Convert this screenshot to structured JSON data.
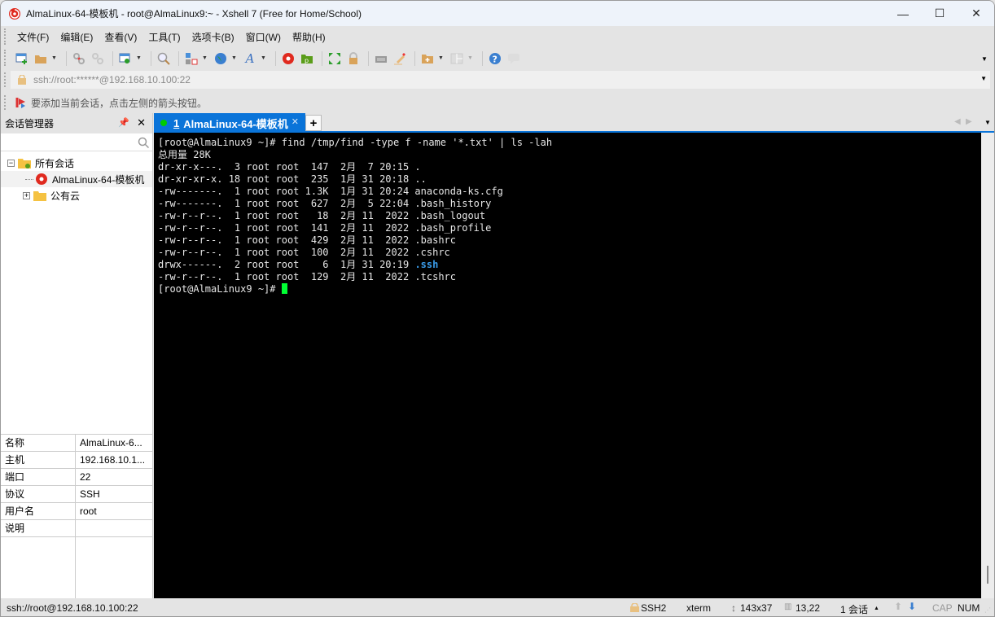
{
  "window": {
    "title": "AlmaLinux-64-模板机 - root@AlmaLinux9:~ - Xshell 7 (Free for Home/School)",
    "controls": {
      "minimize": "—",
      "maximize": "☐",
      "close": "✕"
    }
  },
  "menu": [
    "文件(F)",
    "编辑(E)",
    "查看(V)",
    "工具(T)",
    "选项卡(B)",
    "窗口(W)",
    "帮助(H)"
  ],
  "toolbar": {
    "icons": [
      "new-session-icon",
      "open-folder-icon",
      "disconnect-icon",
      "reconnect-icon",
      "session-properties-icon",
      "find-icon",
      "transfer-icon",
      "globe-icon",
      "font-icon",
      "xshell-icon",
      "xftp-icon",
      "fullscreen-icon",
      "lock-icon",
      "keyboard-icon",
      "highlight-icon",
      "new-tab-group-icon",
      "layout-icon",
      "help-icon",
      "chat-icon"
    ]
  },
  "address": {
    "value": "ssh://root:******@192.168.10.100:22"
  },
  "hint": "要添加当前会话，点击左侧的箭头按钮。",
  "session_manager": {
    "title": "会话管理器",
    "search_placeholder": "",
    "tree": {
      "root": "所有会话",
      "session": "AlmaLinux-64-模板机",
      "folder": "公有云"
    },
    "properties": [
      {
        "key": "名称",
        "value": "AlmaLinux-6..."
      },
      {
        "key": "主机",
        "value": "192.168.10.1..."
      },
      {
        "key": "端口",
        "value": "22"
      },
      {
        "key": "协议",
        "value": "SSH"
      },
      {
        "key": "用户名",
        "value": "root"
      },
      {
        "key": "说明",
        "value": ""
      }
    ]
  },
  "tabs": [
    {
      "index": "1",
      "label": "AlmaLinux-64-模板机",
      "status_color": "#00cc00"
    }
  ],
  "terminal": {
    "lines": [
      "[root@AlmaLinux9 ~]# find /tmp/find -type f -name '*.txt' | ls -lah",
      "总用量 28K",
      "dr-xr-x---.  3 root root  147  2月  7 20:15 .",
      "dr-xr-xr-x. 18 root root  235  1月 31 20:18 ..",
      "-rw-------.  1 root root 1.3K  1月 31 20:24 anaconda-ks.cfg",
      "-rw-------.  1 root root  627  2月  5 22:04 .bash_history",
      "-rw-r--r--.  1 root root   18  2月 11  2022 .bash_logout",
      "-rw-r--r--.  1 root root  141  2月 11  2022 .bash_profile",
      "-rw-r--r--.  1 root root  429  2月 11  2022 .bashrc",
      "-rw-r--r--.  1 root root  100  2月 11  2022 .cshrc",
      "drwx------.  2 root root    6  1月 31 20:19 ",
      "-rw-r--r--.  1 root root  129  2月 11  2022 .tcshrc"
    ],
    "ssh_dir": ".ssh",
    "prompt": "[root@AlmaLinux9 ~]# "
  },
  "status": {
    "connection": "ssh://root@192.168.10.100:22",
    "protocol": "SSH2",
    "term": "xterm",
    "size": "143x37",
    "cursor_pos": "13,22",
    "sessions": "1 会话",
    "cap": "CAP",
    "num": "NUM"
  }
}
